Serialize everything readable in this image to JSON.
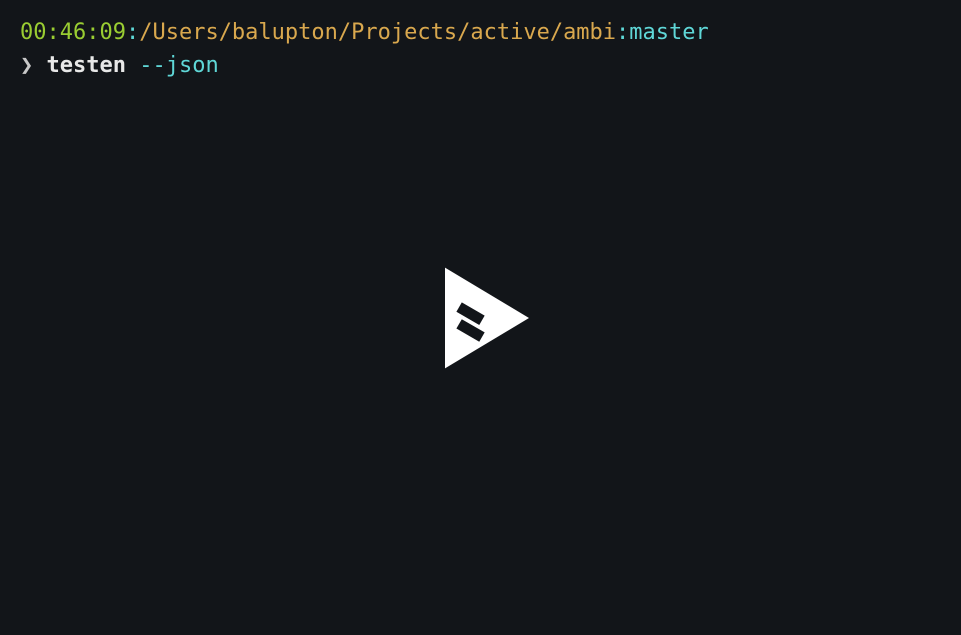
{
  "terminal": {
    "prompt": {
      "time": "00:46:09",
      "separator1": ":",
      "path": "/Users/balupton/Projects/active/ambi",
      "separator2": ":",
      "branch": "master"
    },
    "command_line": {
      "symbol": "❯ ",
      "command": "testen",
      "flag": " --json"
    }
  },
  "colors": {
    "background": "#121519",
    "time": "#9acd32",
    "separator": "#5fd7d7",
    "path": "#d9a84e",
    "branch": "#5fd7d7",
    "command": "#e8e8e8",
    "flag": "#5fd7d7"
  }
}
